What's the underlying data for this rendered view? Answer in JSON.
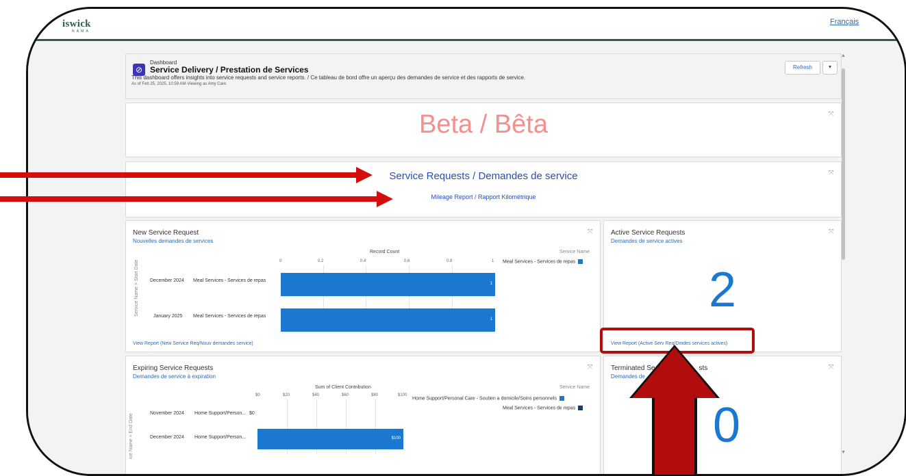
{
  "topbar": {
    "logo": "iswick",
    "logo_sub": "N A M A",
    "lang_link": "Français"
  },
  "header": {
    "label": "Dashboard",
    "title": "Service Delivery / Prestation de Services",
    "description": "This dashboard offers insights into service requests and service reports. / Ce tableau de bord offre un aperçu des demandes de service et des rapports de service.",
    "as_of": "As of Feb 25, 2025, 10:59 AM·Viewing as Amy Care",
    "refresh": "Refresh",
    "menu_icon": "▼"
  },
  "beta": {
    "text": "Beta / Bêta"
  },
  "links": {
    "service_requests": "Service Requests / Demandes de service",
    "mileage_report": "Mileage Report / Rapport Kilométrique"
  },
  "new_requests": {
    "title": "New Service Request",
    "subtitle": "Nouvelles demandes de services",
    "link": "View Report (New Service Req/Nouv demandes service)"
  },
  "active_requests": {
    "title": "Active Service Requests",
    "subtitle": "Demandes de service actives",
    "value": "2",
    "link": "View Report (Active Serv Req/Dmdes services actives)"
  },
  "expiring_requests": {
    "title": "Expiring Service Requests",
    "subtitle": "Demandes de service à expiration"
  },
  "terminated_requests": {
    "title": "Terminated Se",
    "title_end": "sts",
    "subtitle": "Demandes de",
    "value": "0"
  },
  "colors": {
    "accent": "#1b78d0",
    "dark_series": "#1d3a6e",
    "beta": "#f1908c",
    "annotation": "#d40d0d",
    "topbar_line": "#2f5d4e"
  },
  "chart_data": [
    {
      "type": "bar",
      "orientation": "horizontal",
      "title": "Record Count",
      "y_axis_label": "Service Name > Start Date",
      "categories": [
        "December 2024",
        "January 2025"
      ],
      "row_labels": [
        "Meal Services - Services de repas",
        "Meal Services - Services de repas"
      ],
      "xlim": [
        0,
        1
      ],
      "ticks": [
        "0",
        "0.2",
        "0.4",
        "0.6",
        "0.8",
        "1"
      ],
      "legend_title": "Service Name",
      "series": [
        {
          "name": "Meal Services - Services de repas",
          "color": "#1b78d0",
          "values": [
            1,
            1
          ]
        }
      ]
    },
    {
      "type": "bar",
      "orientation": "horizontal",
      "title": "Sum of Client Contribution",
      "y_axis_label": "ice Name > End Date",
      "categories": [
        "November 2024",
        "December 2024"
      ],
      "row_labels": [
        "Home Support/Person...",
        "Home Support/Person..."
      ],
      "xlim": [
        0,
        100
      ],
      "ticks": [
        "$0",
        "$20",
        "$40",
        "$60",
        "$80",
        "$100"
      ],
      "value_labels": [
        "$0",
        "$100"
      ],
      "legend_title": "Service Name",
      "series": [
        {
          "name": "Home Support/Personal Care - Soutien a domicile/Soins personnels",
          "color": "#1b78d0",
          "values": [
            0,
            100
          ]
        },
        {
          "name": "Meal Services - Services de repas",
          "color": "#1d3a6e",
          "values": []
        }
      ]
    }
  ]
}
